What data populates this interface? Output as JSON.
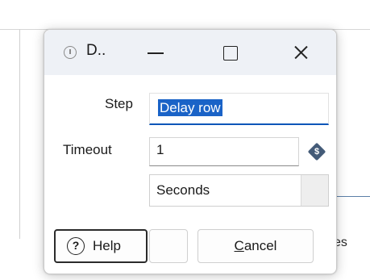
{
  "background": {
    "partial_text": "es"
  },
  "dialog": {
    "title": "D..",
    "icon": "clock-icon",
    "controls": [
      "minimize-icon",
      "maximize-icon",
      "close-icon"
    ],
    "step": {
      "label": "Step",
      "value": "Delay row"
    },
    "timeout": {
      "label": "Timeout",
      "value": "1",
      "variable_icon": "variable-diamond-icon",
      "unit": "Seconds"
    },
    "buttons": {
      "help_label": "Help",
      "ok_label": "",
      "cancel_mnemonic": "C",
      "cancel_rest": "ancel"
    }
  }
}
